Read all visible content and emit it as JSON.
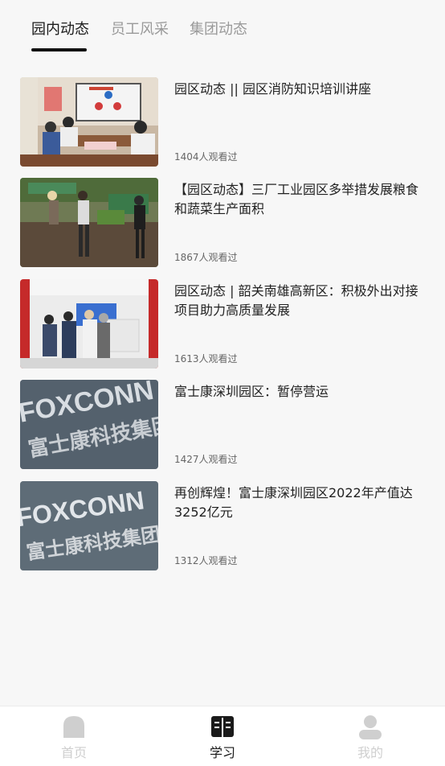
{
  "tabs": [
    {
      "label": "园内动态",
      "active": true
    },
    {
      "label": "员工风采",
      "active": false
    },
    {
      "label": "集团动态",
      "active": false
    }
  ],
  "articles": [
    {
      "title": "园区动态 || 园区消防知识培训讲座",
      "views": "1404人观看过",
      "image": "meeting-room-photo"
    },
    {
      "title": "【园区动态】三厂工业园区多举措发展粮食和蔬菜生产面积",
      "views": "1867人观看过",
      "image": "farm-field-photo"
    },
    {
      "title": "园区动态 | 韶关南雄高新区：积极外出对接项目助力高质量发展",
      "views": "1613人观看过",
      "image": "office-visit-photo"
    },
    {
      "title": "富士康深圳园区：暂停营运",
      "views": "1427人观看过",
      "image": "foxconn-sign-photo"
    },
    {
      "title": "再创辉煌！富士康深圳园区2022年产值达3252亿元",
      "views": "1312人观看过",
      "image": "foxconn-sign-photo"
    }
  ],
  "thumb_text": {
    "foxconn_en": "FOXCONN",
    "foxconn_cn": "富士康科技集团"
  },
  "bottom_nav": [
    {
      "label": "首页",
      "icon": "home-icon",
      "active": false
    },
    {
      "label": "学习",
      "icon": "book-icon",
      "active": true
    },
    {
      "label": "我的",
      "icon": "user-icon",
      "active": false
    }
  ],
  "colors": {
    "active_text": "#1a1a1a",
    "inactive_text": "#9a9a9a",
    "nav_inactive": "#cfcfcf",
    "background": "#f7f7f7"
  }
}
